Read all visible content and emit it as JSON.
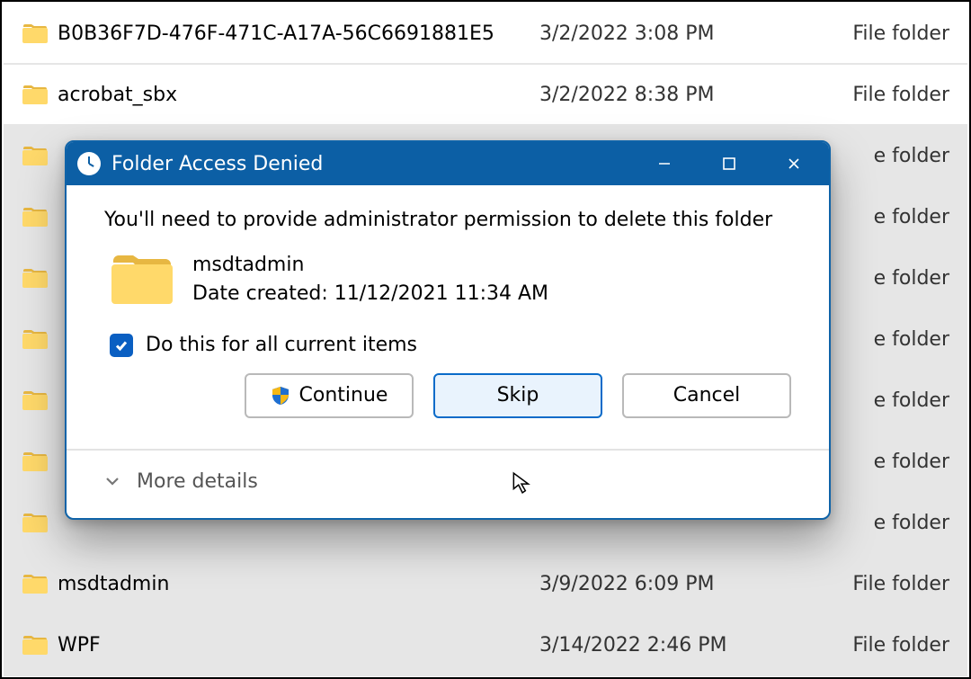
{
  "explorer": {
    "rows": [
      {
        "name": "B0B36F7D-476F-471C-A17A-56C6691881E5",
        "date": "3/2/2022 3:08 PM",
        "type": "File folder",
        "selected": false
      },
      {
        "name": "acrobat_sbx",
        "date": "3/2/2022 8:38 PM",
        "type": "File folder",
        "selected": false
      },
      {
        "name": "",
        "date": "",
        "type": "e folder",
        "selected": true
      },
      {
        "name": "",
        "date": "",
        "type": "e folder",
        "selected": true
      },
      {
        "name": "",
        "date": "",
        "type": "e folder",
        "selected": true
      },
      {
        "name": "",
        "date": "",
        "type": "e folder",
        "selected": true
      },
      {
        "name": "",
        "date": "",
        "type": "e folder",
        "selected": true
      },
      {
        "name": "",
        "date": "",
        "type": "e folder",
        "selected": true
      },
      {
        "name": "",
        "date": "",
        "type": "e folder",
        "selected": true
      },
      {
        "name": "msdtadmin",
        "date": "3/9/2022 6:09 PM",
        "type": "File folder",
        "selected": true
      },
      {
        "name": "WPF",
        "date": "3/14/2022 2:46 PM",
        "type": "File folder",
        "selected": true
      }
    ]
  },
  "dialog": {
    "title": "Folder Access Denied",
    "message": "You'll need to provide administrator permission to delete this folder",
    "object_name": "msdtadmin",
    "object_meta": "Date created: 11/12/2021 11:34 AM",
    "checkbox_label": "Do this for all current items",
    "checkbox_checked": true,
    "continue_label": "Continue",
    "skip_label": "Skip",
    "cancel_label": "Cancel",
    "more_label": "More details",
    "titlebar_color": "#0c5fa5"
  }
}
